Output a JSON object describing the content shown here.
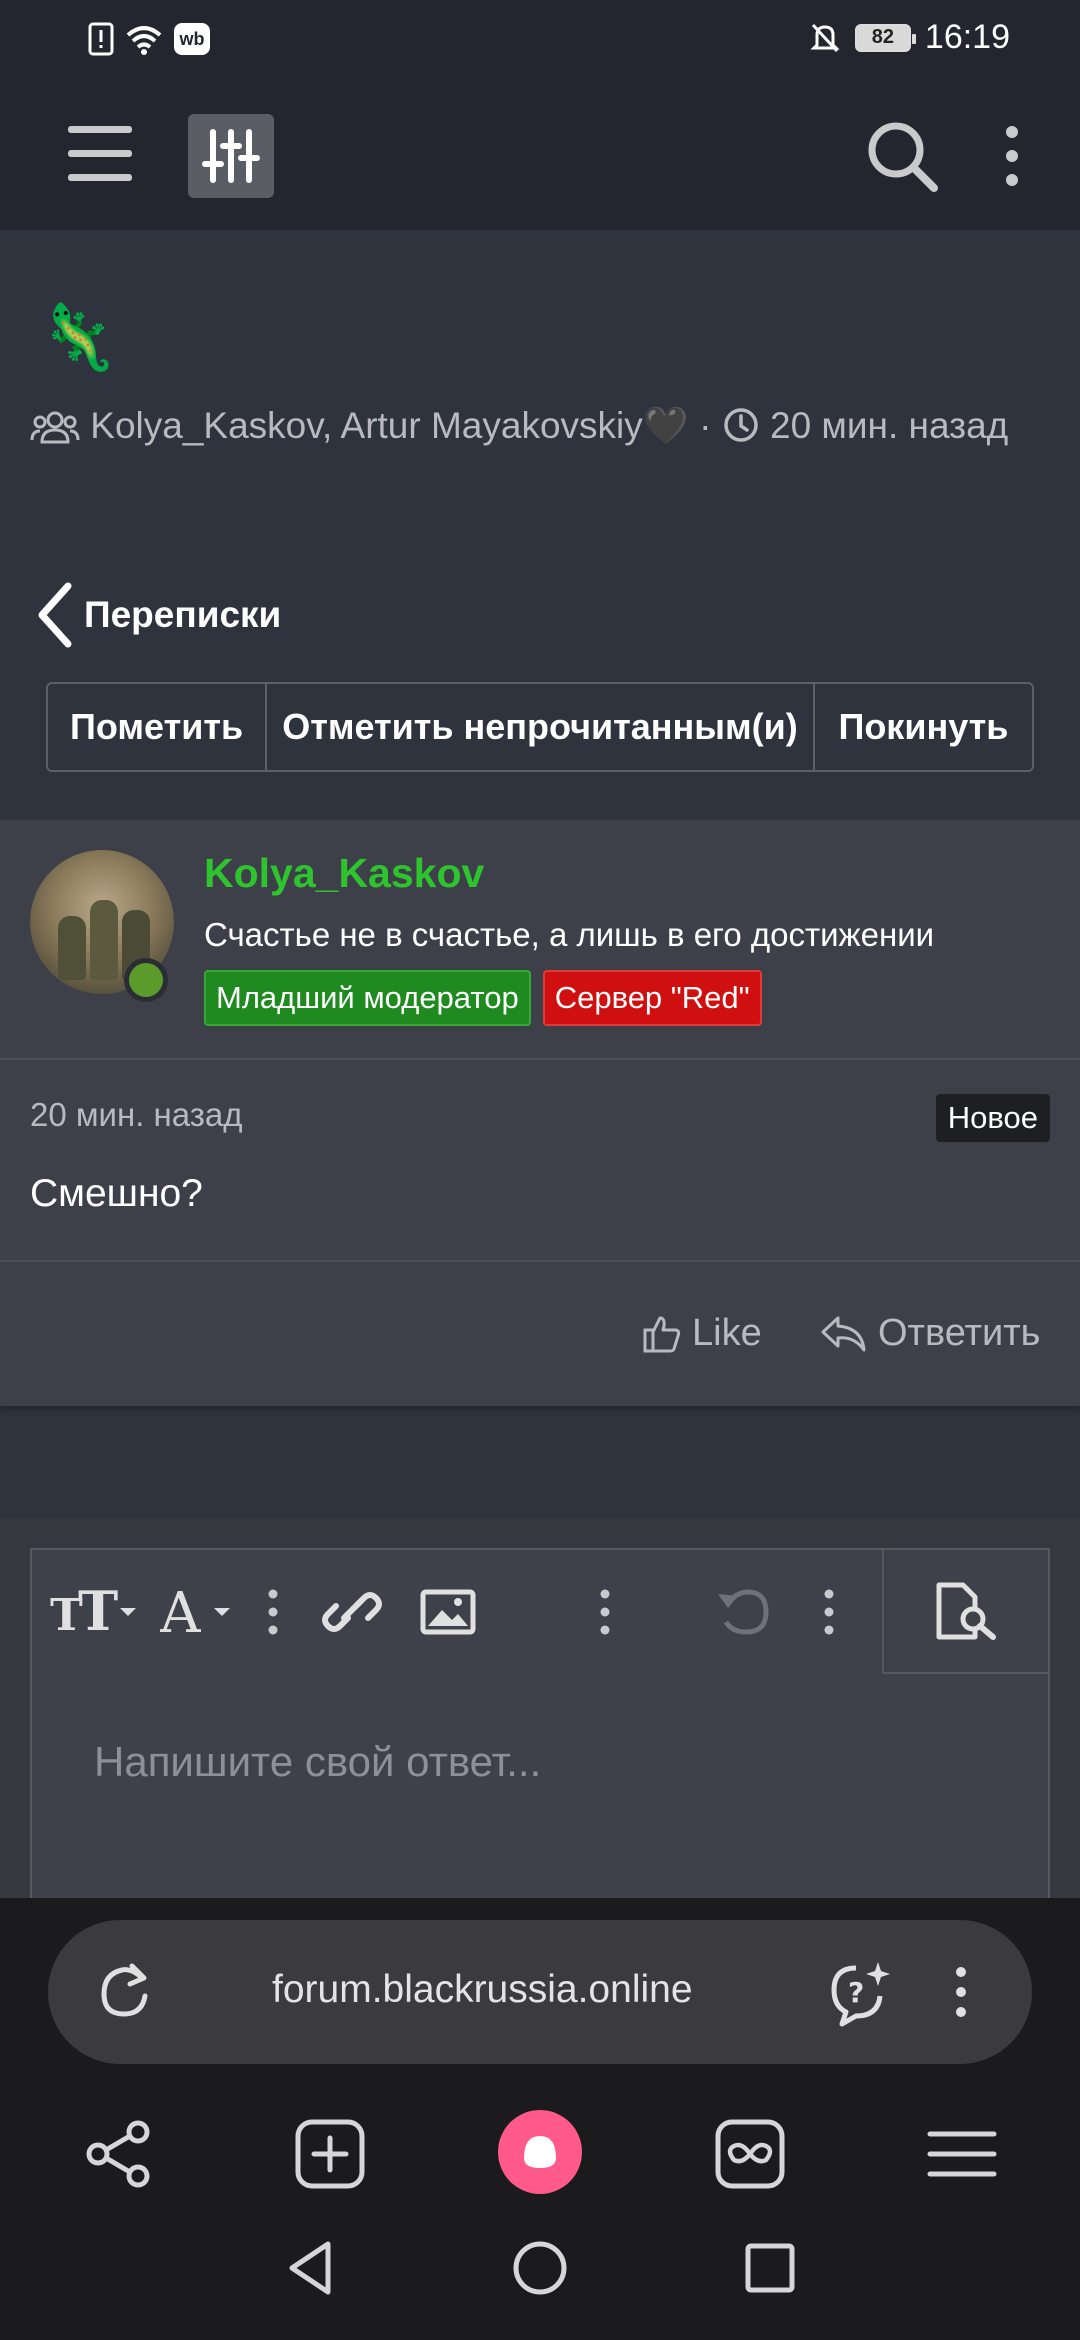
{
  "status_bar": {
    "time": "16:19",
    "battery": "82",
    "icons": [
      "alert-icon",
      "wifi-icon",
      "wb-icon",
      "bell-off-icon"
    ]
  },
  "app_header": {
    "icons": [
      "hamburger-icon",
      "sliders-icon",
      "search-icon",
      "more-vert-icon"
    ]
  },
  "thread": {
    "emoji": "🦎",
    "participants": "Kolya_Kaskov, Artur Mayakovskiy🖤",
    "separator": "·",
    "time": "20 мин. назад"
  },
  "back": {
    "label": "Переписки"
  },
  "actions": [
    "Пометить",
    "Отметить непрочитанным(и)",
    "Покинуть"
  ],
  "message": {
    "username": "Kolya_Kaskov",
    "user_title": "Счастье не в счастье, а лишь в его достижении",
    "badges": [
      {
        "label": "Младший модератор",
        "color": "#1f8a1f"
      },
      {
        "label": "Сервер \"Red\"",
        "color": "#d01010"
      }
    ],
    "time": "20 мин. назад",
    "new_label": "Новое",
    "text": "Смешно?",
    "like_label": "Like",
    "reply_label": "Ответить"
  },
  "editor": {
    "placeholder": "Напишите свой ответ...",
    "tools": [
      "text-size-icon",
      "font-color-icon",
      "more-vert-icon",
      "link-icon",
      "image-icon",
      "more-vert-icon",
      "undo-icon",
      "more-vert-icon",
      "preview-icon"
    ]
  },
  "browser": {
    "url": "forum.blackrussia.online",
    "nav_icons": [
      "share-icon",
      "new-tab-icon",
      "alice-icon",
      "tabs-icon",
      "menu-icon"
    ]
  },
  "colors": {
    "background": "#2f333d",
    "username": "#2ec42e",
    "badge_green": "#1f8a1f",
    "badge_red": "#d01010",
    "alice": "#ff5a8a"
  }
}
